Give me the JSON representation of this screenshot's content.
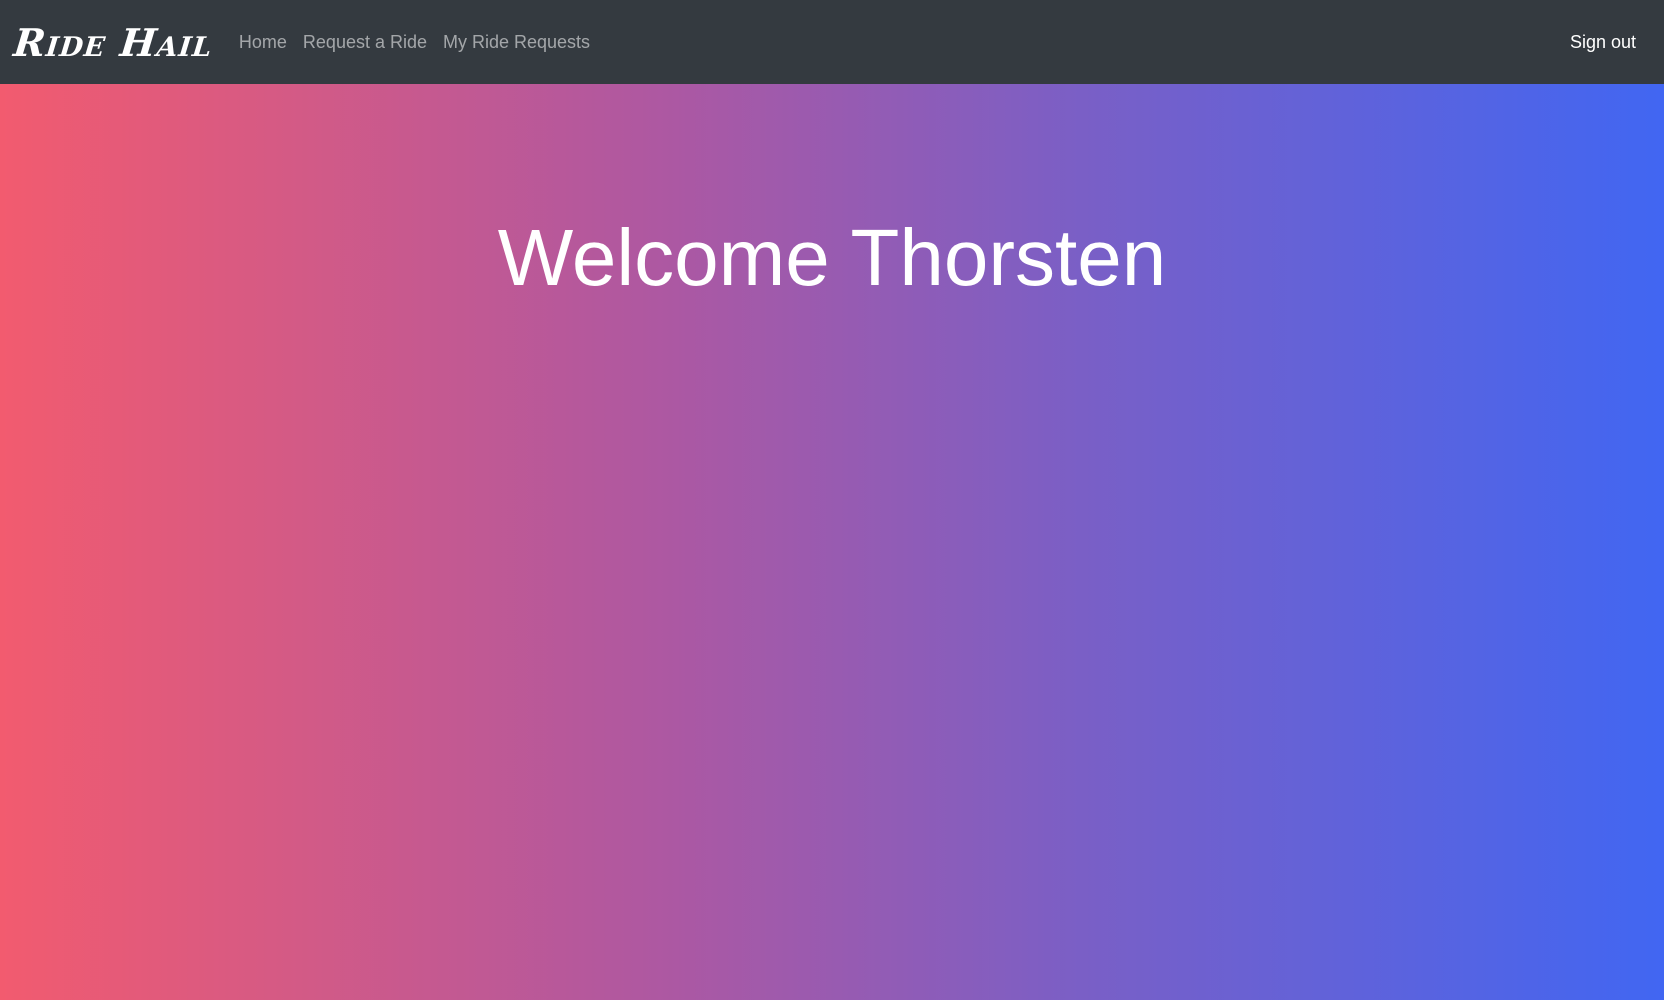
{
  "navbar": {
    "brand": "Ride Hail",
    "links": [
      {
        "label": "Home"
      },
      {
        "label": "Request a Ride"
      },
      {
        "label": "My Ride Requests"
      }
    ],
    "signout_label": "Sign out",
    "background_color": "#343a40"
  },
  "hero": {
    "title": "Welcome Thorsten",
    "gradient_colors": [
      "#f25b6f",
      "#ad58a2",
      "#7a5fc6",
      "#4166f2"
    ]
  }
}
